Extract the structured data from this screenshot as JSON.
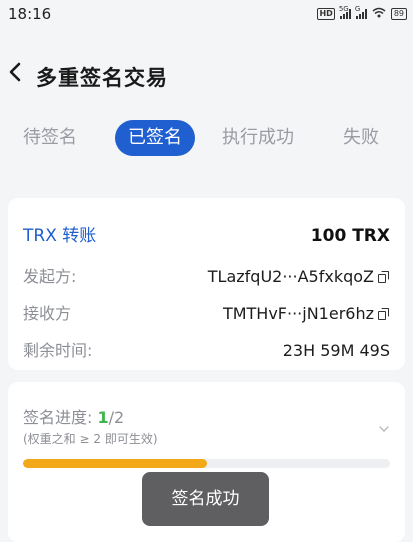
{
  "status_bar": {
    "time": "18:16",
    "hd": "HD",
    "sim1": "5G",
    "sim2": "G",
    "battery": "89"
  },
  "header": {
    "title": "多重签名交易",
    "back_icon": "chevron-left-icon"
  },
  "tabs": [
    {
      "label": "待签名",
      "active": false
    },
    {
      "label": "已签名",
      "active": true
    },
    {
      "label": "执行成功",
      "active": false
    },
    {
      "label": "失败",
      "active": false
    }
  ],
  "transaction": {
    "type": "TRX 转账",
    "amount": "100 TRX",
    "initiator_label": "发起方:",
    "initiator_value": "TLazfqU2···A5fxkqoZ",
    "receiver_label": "接收方",
    "receiver_value": "TMTHvF···jN1er6hz",
    "remaining_label": "剩余时间:",
    "remaining_value": "23H 59M 49S"
  },
  "progress": {
    "label": "签名进度:",
    "done": "1",
    "total": "/2",
    "note": "(权重之和 ≥ 2 即可生效)",
    "fraction": 0.5,
    "color": "#f2a818"
  },
  "toast": {
    "message": "签名成功"
  },
  "colors": {
    "accent": "#1f5fcf",
    "success": "#3fb44f",
    "progress": "#f2a818"
  }
}
